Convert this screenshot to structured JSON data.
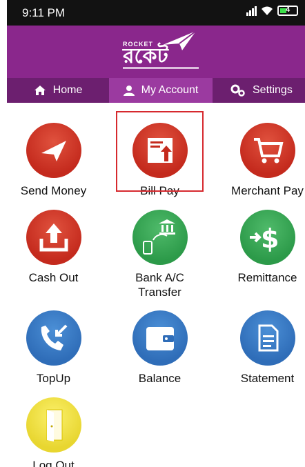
{
  "status": {
    "time": "9:11 PM",
    "battery": "4"
  },
  "header": {
    "brand": "ROCKET",
    "brand_bn": "রকেট"
  },
  "tabs": [
    {
      "label": "Home",
      "icon": "home-icon"
    },
    {
      "label": "My Account",
      "icon": "user-icon"
    },
    {
      "label": "Settings",
      "icon": "gears-icon"
    }
  ],
  "tiles": [
    {
      "label": "Send Money",
      "icon": "paper-plane-icon",
      "color": "#c42a1d"
    },
    {
      "label": "Bill Pay",
      "icon": "bill-upload-icon",
      "color": "#c42a1d"
    },
    {
      "label": "Merchant Pay",
      "icon": "shopping-cart-icon",
      "color": "#c42a1d"
    },
    {
      "label": "Cash Out",
      "icon": "upload-tray-icon",
      "color": "#c42a1d"
    },
    {
      "label": "Bank A/C",
      "label2": "Transfer",
      "icon": "bank-transfer-icon",
      "color": "#2c9a49"
    },
    {
      "label": "Remittance",
      "icon": "dollar-arrow-icon",
      "color": "#2c9a49"
    },
    {
      "label": "TopUp",
      "icon": "phone-call-icon",
      "color": "#2f6db8"
    },
    {
      "label": "Balance",
      "icon": "wallet-icon",
      "color": "#2f6db8"
    },
    {
      "label": "Statement",
      "icon": "document-icon",
      "color": "#2f6db8"
    },
    {
      "label": "Log Out",
      "icon": "door-icon",
      "color": "#e8d630"
    }
  ]
}
